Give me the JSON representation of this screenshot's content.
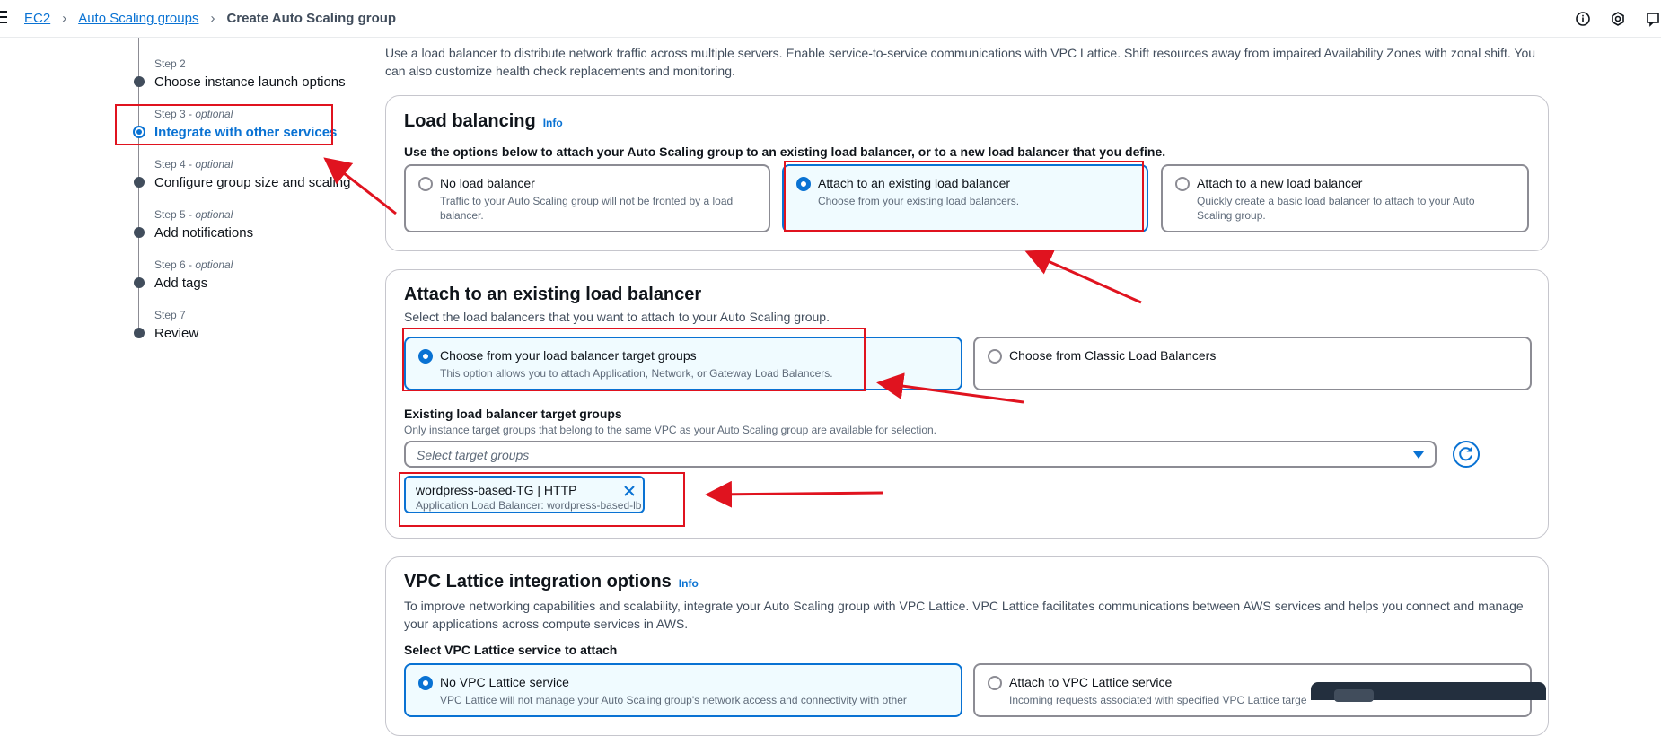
{
  "breadcrumb": {
    "items": [
      "EC2",
      "Auto Scaling groups"
    ],
    "current": "Create Auto Scaling group"
  },
  "steps": [
    {
      "small": "Step 2",
      "optional": "",
      "name": "Choose instance launch options"
    },
    {
      "small": "Step 3 - ",
      "optional": "optional",
      "name": "Integrate with other services",
      "active": true
    },
    {
      "small": "Step 4 - ",
      "optional": "optional",
      "name": "Configure group size and scaling"
    },
    {
      "small": "Step 5 - ",
      "optional": "optional",
      "name": "Add notifications"
    },
    {
      "small": "Step 6 - ",
      "optional": "optional",
      "name": "Add tags"
    },
    {
      "small": "Step 7",
      "optional": "",
      "name": "Review"
    }
  ],
  "intro": "Use a load balancer to distribute network traffic across multiple servers. Enable service-to-service communications with VPC Lattice. Shift resources away from impaired Availability Zones with zonal shift. You can also customize health check replacements and monitoring.",
  "load_balancing": {
    "title": "Load balancing",
    "info": "Info",
    "label": "Use the options below to attach your Auto Scaling group to an existing load balancer, or to a new load balancer that you define.",
    "options": [
      {
        "title": "No load balancer",
        "desc": "Traffic to your Auto Scaling group will not be fronted by a load balancer."
      },
      {
        "title": "Attach to an existing load balancer",
        "desc": "Choose from your existing load balancers.",
        "selected": true
      },
      {
        "title": "Attach to a new load balancer",
        "desc": "Quickly create a basic load balancer to attach to your Auto Scaling group."
      }
    ]
  },
  "existing_lb": {
    "title": "Attach to an existing load balancer",
    "desc": "Select the load balancers that you want to attach to your Auto Scaling group.",
    "options": [
      {
        "title": "Choose from your load balancer target groups",
        "desc": "This option allows you to attach Application, Network, or Gateway Load Balancers.",
        "selected": true
      },
      {
        "title": "Choose from Classic Load Balancers",
        "desc": ""
      }
    ],
    "tg_label": "Existing load balancer target groups",
    "tg_desc": "Only instance target groups that belong to the same VPC as your Auto Scaling group are available for selection.",
    "select_placeholder": "Select target groups",
    "token": {
      "title": "wordpress-based-TG | HTTP",
      "sub": "Application Load Balancer: wordpress-based-lb"
    }
  },
  "vpc_lattice": {
    "title": "VPC Lattice integration options",
    "info": "Info",
    "desc": "To improve networking capabilities and scalability, integrate your Auto Scaling group with VPC Lattice. VPC Lattice facilitates communications between AWS services and helps you connect and manage your applications across compute services in AWS.",
    "label": "Select VPC Lattice service to attach",
    "options": [
      {
        "title": "No VPC Lattice service",
        "desc": "VPC Lattice will not manage your Auto Scaling group's network access and connectivity with other",
        "selected": true
      },
      {
        "title": "Attach to VPC Lattice service",
        "desc": "Incoming requests associated with specified VPC Lattice targe"
      }
    ]
  },
  "colors": {
    "accent": "#0972d3",
    "annotation": "#e0131f"
  },
  "icons": [
    "menu-icon",
    "chevron-right-icon",
    "info-circle-icon",
    "settings-hex-icon",
    "notification-icon",
    "refresh-icon",
    "close-icon",
    "caret-down-icon"
  ]
}
